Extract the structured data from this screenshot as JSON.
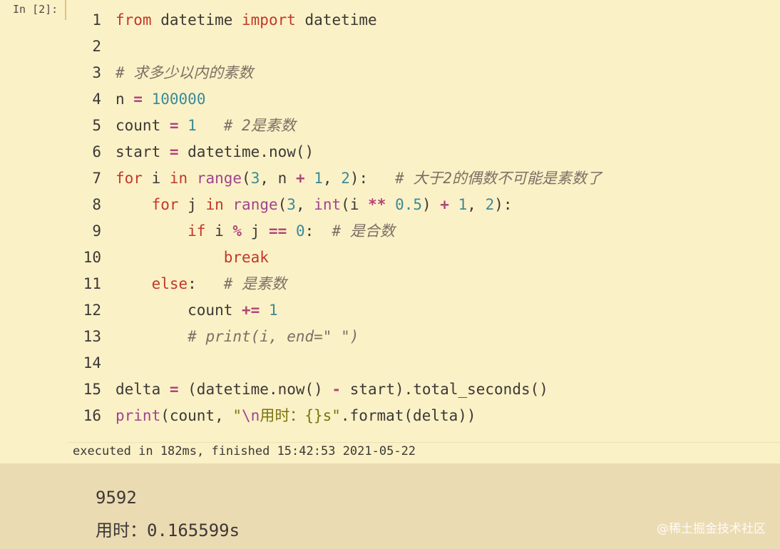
{
  "cell": {
    "prompt": "In [2]:",
    "lines": [
      {
        "no": "1",
        "tokens": [
          {
            "t": "from",
            "c": "kw"
          },
          {
            "t": " datetime ",
            "c": "plain"
          },
          {
            "t": "import",
            "c": "kw"
          },
          {
            "t": " datetime",
            "c": "plain"
          }
        ]
      },
      {
        "no": "2",
        "tokens": []
      },
      {
        "no": "3",
        "tokens": [
          {
            "t": "# 求多少以内的素数",
            "c": "cm"
          }
        ]
      },
      {
        "no": "4",
        "tokens": [
          {
            "t": "n ",
            "c": "plain"
          },
          {
            "t": "=",
            "c": "op"
          },
          {
            "t": " ",
            "c": "plain"
          },
          {
            "t": "100000",
            "c": "num"
          }
        ]
      },
      {
        "no": "5",
        "tokens": [
          {
            "t": "count ",
            "c": "plain"
          },
          {
            "t": "=",
            "c": "op"
          },
          {
            "t": " ",
            "c": "plain"
          },
          {
            "t": "1",
            "c": "num"
          },
          {
            "t": "   ",
            "c": "plain"
          },
          {
            "t": "# 2是素数",
            "c": "cm"
          }
        ]
      },
      {
        "no": "6",
        "tokens": [
          {
            "t": "start ",
            "c": "plain"
          },
          {
            "t": "=",
            "c": "op"
          },
          {
            "t": " datetime.now()",
            "c": "plain"
          }
        ]
      },
      {
        "no": "7",
        "tokens": [
          {
            "t": "for",
            "c": "kw"
          },
          {
            "t": " i ",
            "c": "plain"
          },
          {
            "t": "in",
            "c": "kw"
          },
          {
            "t": " ",
            "c": "plain"
          },
          {
            "t": "range",
            "c": "fn"
          },
          {
            "t": "(",
            "c": "plain"
          },
          {
            "t": "3",
            "c": "num"
          },
          {
            "t": ", n ",
            "c": "plain"
          },
          {
            "t": "+",
            "c": "op"
          },
          {
            "t": " ",
            "c": "plain"
          },
          {
            "t": "1",
            "c": "num"
          },
          {
            "t": ", ",
            "c": "plain"
          },
          {
            "t": "2",
            "c": "num"
          },
          {
            "t": "):   ",
            "c": "plain"
          },
          {
            "t": "# 大于2的偶数不可能是素数了",
            "c": "cm"
          }
        ]
      },
      {
        "no": "8",
        "tokens": [
          {
            "t": "    ",
            "c": "plain"
          },
          {
            "t": "for",
            "c": "kw"
          },
          {
            "t": " j ",
            "c": "plain"
          },
          {
            "t": "in",
            "c": "kw"
          },
          {
            "t": " ",
            "c": "plain"
          },
          {
            "t": "range",
            "c": "fn"
          },
          {
            "t": "(",
            "c": "plain"
          },
          {
            "t": "3",
            "c": "num"
          },
          {
            "t": ", ",
            "c": "plain"
          },
          {
            "t": "int",
            "c": "fn"
          },
          {
            "t": "(i ",
            "c": "plain"
          },
          {
            "t": "**",
            "c": "op"
          },
          {
            "t": " ",
            "c": "plain"
          },
          {
            "t": "0.5",
            "c": "num"
          },
          {
            "t": ") ",
            "c": "plain"
          },
          {
            "t": "+",
            "c": "op"
          },
          {
            "t": " ",
            "c": "plain"
          },
          {
            "t": "1",
            "c": "num"
          },
          {
            "t": ", ",
            "c": "plain"
          },
          {
            "t": "2",
            "c": "num"
          },
          {
            "t": "):",
            "c": "plain"
          }
        ]
      },
      {
        "no": "9",
        "tokens": [
          {
            "t": "        ",
            "c": "plain"
          },
          {
            "t": "if",
            "c": "kw"
          },
          {
            "t": " i ",
            "c": "plain"
          },
          {
            "t": "%",
            "c": "op"
          },
          {
            "t": " j ",
            "c": "plain"
          },
          {
            "t": "==",
            "c": "op"
          },
          {
            "t": " ",
            "c": "plain"
          },
          {
            "t": "0",
            "c": "num"
          },
          {
            "t": ":  ",
            "c": "plain"
          },
          {
            "t": "# 是合数",
            "c": "cm"
          }
        ]
      },
      {
        "no": "10",
        "tokens": [
          {
            "t": "            ",
            "c": "plain"
          },
          {
            "t": "break",
            "c": "kw"
          }
        ]
      },
      {
        "no": "11",
        "tokens": [
          {
            "t": "    ",
            "c": "plain"
          },
          {
            "t": "else",
            "c": "kw"
          },
          {
            "t": ":   ",
            "c": "plain"
          },
          {
            "t": "# 是素数",
            "c": "cm"
          }
        ]
      },
      {
        "no": "12",
        "tokens": [
          {
            "t": "        count ",
            "c": "plain"
          },
          {
            "t": "+=",
            "c": "op"
          },
          {
            "t": " ",
            "c": "plain"
          },
          {
            "t": "1",
            "c": "num"
          }
        ]
      },
      {
        "no": "13",
        "tokens": [
          {
            "t": "        ",
            "c": "plain"
          },
          {
            "t": "# print(i, end=\" \")",
            "c": "cm"
          }
        ]
      },
      {
        "no": "14",
        "tokens": []
      },
      {
        "no": "15",
        "tokens": [
          {
            "t": "delta ",
            "c": "plain"
          },
          {
            "t": "=",
            "c": "op"
          },
          {
            "t": " (datetime.now() ",
            "c": "plain"
          },
          {
            "t": "-",
            "c": "op"
          },
          {
            "t": " start).total_seconds()",
            "c": "plain"
          }
        ]
      },
      {
        "no": "16",
        "tokens": [
          {
            "t": "print",
            "c": "fn"
          },
          {
            "t": "(count, ",
            "c": "plain"
          },
          {
            "t": "\"",
            "c": "str"
          },
          {
            "t": "\\n",
            "c": "esc"
          },
          {
            "t": "用时：{}s\"",
            "c": "str"
          },
          {
            "t": ".format(delta))",
            "c": "plain"
          }
        ]
      }
    ],
    "exec_info": "executed in 182ms, finished 15:42:53 2021-05-22"
  },
  "output": {
    "line1": "9592",
    "line2": "用时：0.165599s"
  },
  "watermark": "@稀土掘金技术社区",
  "colors": {
    "cell_bg": "#fbf1c7",
    "output_bg": "#ebdbb2",
    "keyword": "#c0392b",
    "number": "#3a8a99",
    "comment": "#7c6f64",
    "string": "#79740e"
  }
}
